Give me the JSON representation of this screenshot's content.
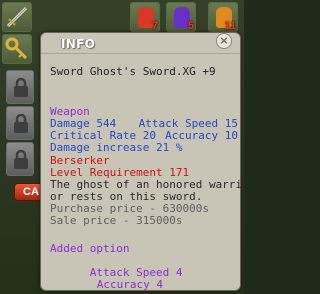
{
  "inventory": {
    "top_items": [
      {
        "name": "red-bell-potion",
        "qty": "7",
        "color": "#d63a25"
      },
      {
        "name": "purple-bell-potion",
        "qty": "5",
        "color": "#6a2fc8"
      },
      {
        "name": "orange-bell-potion",
        "qty": "11",
        "color": "#e08a1c"
      }
    ],
    "bottom_button_label": "CA"
  },
  "tooltip": {
    "title": "INFO",
    "close_glyph": "×",
    "item_name": "Sword Ghost's Sword.XG +9",
    "category": "Weapon",
    "damage_label": "Damage 544",
    "attack_speed_label": "Attack Speed 15",
    "critical_rate_label": "Critical Rate 20",
    "accuracy_label": "Accuracy 10",
    "damage_increase": "Damage increase 21 %",
    "class_name": "Berserker",
    "level_requirement": "Level Requirement 171",
    "description_line1": "The ghost of an honored warri",
    "description_line2": "or rests on this sword.",
    "purchase_price": "Purchase price - 630000s",
    "sale_price": "Sale price - 315000s",
    "added_option_header": "Added option",
    "added_attack_speed": "Attack Speed 4",
    "added_accuracy": "Accuracy 4"
  }
}
